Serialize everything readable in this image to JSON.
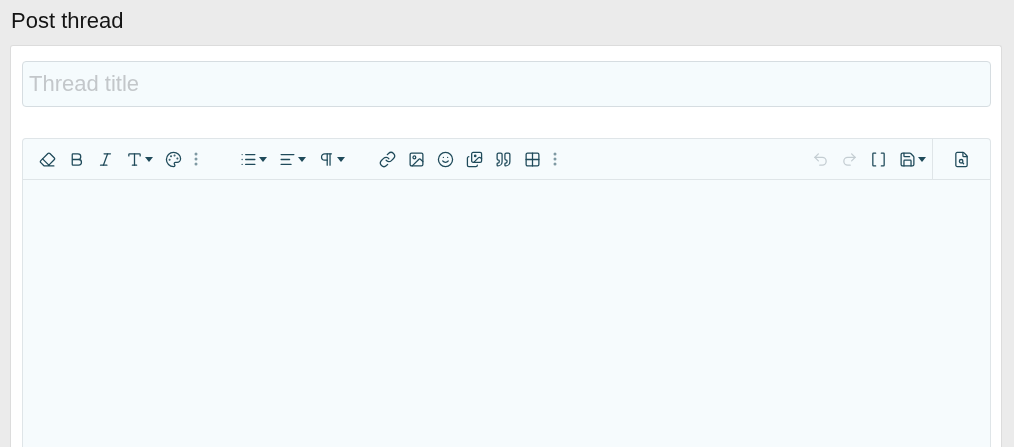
{
  "page": {
    "title": "Post thread"
  },
  "title_field": {
    "placeholder": "Thread title"
  },
  "editor": {
    "toolbar": {
      "groups": [
        {
          "buttons": [
            {
              "dropdown": false,
              "disabled": false
            },
            {
              "dropdown": false,
              "disabled": false
            },
            {
              "dropdown": false,
              "disabled": false
            },
            {
              "dropdown": true,
              "disabled": false
            },
            {
              "dropdown": false,
              "disabled": false
            },
            {
              "dropdown": false,
              "disabled": false
            }
          ]
        },
        {
          "buttons": [
            {
              "dropdown": true,
              "disabled": false
            },
            {
              "dropdown": true,
              "disabled": false
            },
            {
              "dropdown": true,
              "disabled": false
            }
          ]
        },
        {
          "buttons": [
            {
              "dropdown": false,
              "disabled": false
            },
            {
              "dropdown": false,
              "disabled": false
            },
            {
              "dropdown": false,
              "disabled": false
            },
            {
              "dropdown": false,
              "disabled": false
            },
            {
              "dropdown": false,
              "disabled": false
            },
            {
              "dropdown": false,
              "disabled": false
            },
            {
              "dropdown": false,
              "disabled": false
            }
          ]
        },
        {
          "buttons": [
            {
              "dropdown": false,
              "disabled": true
            },
            {
              "dropdown": false,
              "disabled": true
            },
            {
              "dropdown": false,
              "disabled": false
            },
            {
              "dropdown": true,
              "disabled": false
            }
          ]
        },
        {
          "buttons": [
            {
              "dropdown": false,
              "disabled": false
            }
          ]
        }
      ]
    }
  }
}
